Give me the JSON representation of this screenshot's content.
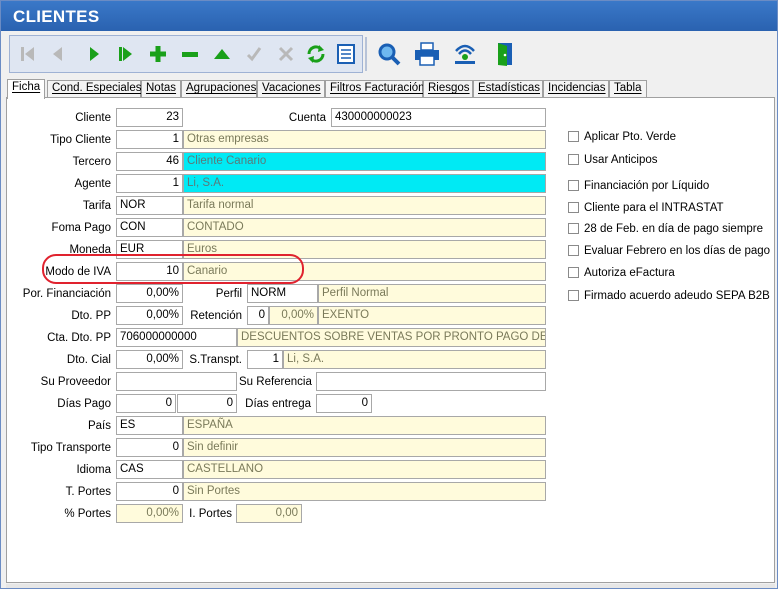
{
  "window": {
    "title": "CLIENTES"
  },
  "toolbar": {
    "buttons": [
      {
        "name": "first-record-icon"
      },
      {
        "name": "previous-record-icon"
      },
      {
        "name": "next-record-icon"
      },
      {
        "name": "last-record-icon"
      },
      {
        "name": "add-record-icon"
      },
      {
        "name": "delete-record-icon"
      },
      {
        "name": "edit-record-icon"
      },
      {
        "name": "confirm-icon"
      },
      {
        "name": "cancel-icon"
      },
      {
        "name": "refresh-icon"
      },
      {
        "name": "list-view-icon"
      }
    ],
    "extra": [
      {
        "name": "search-icon"
      },
      {
        "name": "print-icon"
      },
      {
        "name": "connect-icon"
      },
      {
        "name": "exit-door-icon"
      }
    ],
    "colors": {
      "green": "#1aa01a",
      "grey": "#b0b0b0",
      "blue": "#1a5fb4"
    }
  },
  "tabs": [
    {
      "label": "Ficha"
    },
    {
      "label": "Cond. Especiales"
    },
    {
      "label": "Notas"
    },
    {
      "label": "Agrupaciones"
    },
    {
      "label": "Vacaciones"
    },
    {
      "label": "Filtros Facturación"
    },
    {
      "label": "Riesgos"
    },
    {
      "label": "Estadísticas"
    },
    {
      "label": "Incidencias"
    },
    {
      "label": "Tabla"
    }
  ],
  "form": {
    "cliente": {
      "label": "Cliente",
      "value": "23"
    },
    "cuenta": {
      "label": "Cuenta",
      "value": "430000000023"
    },
    "tipo_cliente": {
      "label": "Tipo Cliente",
      "code": "1",
      "desc": "Otras empresas"
    },
    "tercero": {
      "label": "Tercero",
      "code": "46",
      "desc": "Cliente Canario"
    },
    "agente": {
      "label": "Agente",
      "code": "1",
      "desc": "Li, S.A."
    },
    "tarifa": {
      "label": "Tarifa",
      "code": "NOR",
      "desc": "Tarifa normal"
    },
    "forma_pago": {
      "label": "Foma Pago",
      "code": "CON",
      "desc": "CONTADO"
    },
    "moneda": {
      "label": "Moneda",
      "code": "EUR",
      "desc": "Euros"
    },
    "modo_iva": {
      "label": "Modo de IVA",
      "code": "10",
      "desc": "Canario"
    },
    "por_financiacion": {
      "label": "Por. Financiación",
      "value": "0,00%"
    },
    "perfil": {
      "label": "Perfil",
      "code": "NORM",
      "desc": "Perfil Normal"
    },
    "dto_pp": {
      "label": "Dto. PP",
      "value": "0,00%"
    },
    "retencion": {
      "label": "Retención",
      "code": "0",
      "pct": "0,00%",
      "desc": "EXENTO"
    },
    "cta_dto_pp": {
      "label": "Cta. Dto. PP",
      "code": "706000000000",
      "desc": "DESCUENTOS SOBRE VENTAS POR PRONTO PAGO DE MI"
    },
    "dto_cial": {
      "label": "Dto. Cial",
      "value": "0,00%"
    },
    "s_transpt": {
      "label": "S.Transpt.",
      "code": "1",
      "desc": "Li, S.A."
    },
    "su_proveedor": {
      "label": "Su Proveedor",
      "value": ""
    },
    "su_referencia": {
      "label": "Su Referencia",
      "value": ""
    },
    "dias_pago": {
      "label": "Días Pago",
      "value1": "0",
      "value2": "0"
    },
    "dias_entrega": {
      "label": "Días entrega",
      "value": "0"
    },
    "pais": {
      "label": "País",
      "code": "ES",
      "desc": "ESPAÑA"
    },
    "tipo_transporte": {
      "label": "Tipo Transporte",
      "code": "0",
      "desc": "Sin definir"
    },
    "idioma": {
      "label": "Idioma",
      "code": "CAS",
      "desc": "CASTELLANO"
    },
    "t_portes": {
      "label": "T. Portes",
      "code": "0",
      "desc": "Sin Portes"
    },
    "pct_portes": {
      "label": "% Portes",
      "value": "0,00%"
    },
    "i_portes": {
      "label": "I. Portes",
      "value": "0,00"
    }
  },
  "checkboxes": [
    {
      "label": "Aplicar Pto. Verde"
    },
    {
      "label": "Usar Anticipos"
    },
    {
      "label": "Financiación por Líquido"
    },
    {
      "label": "Cliente para el INTRASTAT"
    },
    {
      "label": "28 de Feb. en día de pago siempre"
    },
    {
      "label": "Evaluar Febrero en los días de pago"
    },
    {
      "label": "Autoriza eFactura"
    },
    {
      "label": "Firmado acuerdo adeudo SEPA B2B"
    }
  ]
}
